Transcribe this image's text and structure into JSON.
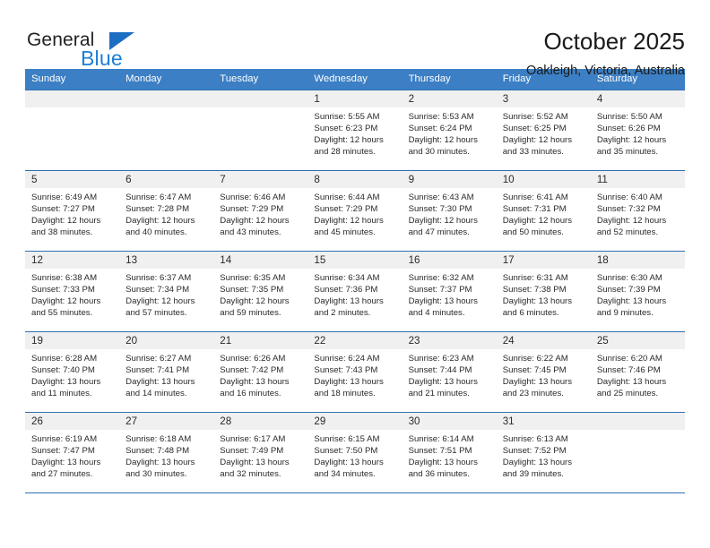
{
  "brand": {
    "name_top": "General",
    "name_bottom": "Blue",
    "triangle_color": "#1b6ec2",
    "blue_color": "#1b7fd4"
  },
  "header": {
    "title": "October 2025",
    "subtitle": "Oakleigh, Victoria, Australia"
  },
  "theme": {
    "header_row_bg": "#3c7fc4",
    "header_row_text": "#ffffff",
    "row_divider": "#2f6fae",
    "datenum_bg": "#f0f0f0",
    "text": "#2a2a2a"
  },
  "calendar": {
    "weekday_headers": [
      "Sunday",
      "Monday",
      "Tuesday",
      "Wednesday",
      "Thursday",
      "Friday",
      "Saturday"
    ],
    "labels": {
      "sunrise": "Sunrise:",
      "sunset": "Sunset:",
      "daylight": "Daylight:"
    },
    "weeks": [
      [
        {
          "day": "",
          "empty": true
        },
        {
          "day": "",
          "empty": true
        },
        {
          "day": "",
          "empty": true
        },
        {
          "day": "1",
          "sunrise": "Sunrise: 5:55 AM",
          "sunset": "Sunset: 6:23 PM",
          "daylight1": "Daylight: 12 hours",
          "daylight2": "and 28 minutes."
        },
        {
          "day": "2",
          "sunrise": "Sunrise: 5:53 AM",
          "sunset": "Sunset: 6:24 PM",
          "daylight1": "Daylight: 12 hours",
          "daylight2": "and 30 minutes."
        },
        {
          "day": "3",
          "sunrise": "Sunrise: 5:52 AM",
          "sunset": "Sunset: 6:25 PM",
          "daylight1": "Daylight: 12 hours",
          "daylight2": "and 33 minutes."
        },
        {
          "day": "4",
          "sunrise": "Sunrise: 5:50 AM",
          "sunset": "Sunset: 6:26 PM",
          "daylight1": "Daylight: 12 hours",
          "daylight2": "and 35 minutes."
        }
      ],
      [
        {
          "day": "5",
          "sunrise": "Sunrise: 6:49 AM",
          "sunset": "Sunset: 7:27 PM",
          "daylight1": "Daylight: 12 hours",
          "daylight2": "and 38 minutes."
        },
        {
          "day": "6",
          "sunrise": "Sunrise: 6:47 AM",
          "sunset": "Sunset: 7:28 PM",
          "daylight1": "Daylight: 12 hours",
          "daylight2": "and 40 minutes."
        },
        {
          "day": "7",
          "sunrise": "Sunrise: 6:46 AM",
          "sunset": "Sunset: 7:29 PM",
          "daylight1": "Daylight: 12 hours",
          "daylight2": "and 43 minutes."
        },
        {
          "day": "8",
          "sunrise": "Sunrise: 6:44 AM",
          "sunset": "Sunset: 7:29 PM",
          "daylight1": "Daylight: 12 hours",
          "daylight2": "and 45 minutes."
        },
        {
          "day": "9",
          "sunrise": "Sunrise: 6:43 AM",
          "sunset": "Sunset: 7:30 PM",
          "daylight1": "Daylight: 12 hours",
          "daylight2": "and 47 minutes."
        },
        {
          "day": "10",
          "sunrise": "Sunrise: 6:41 AM",
          "sunset": "Sunset: 7:31 PM",
          "daylight1": "Daylight: 12 hours",
          "daylight2": "and 50 minutes."
        },
        {
          "day": "11",
          "sunrise": "Sunrise: 6:40 AM",
          "sunset": "Sunset: 7:32 PM",
          "daylight1": "Daylight: 12 hours",
          "daylight2": "and 52 minutes."
        }
      ],
      [
        {
          "day": "12",
          "sunrise": "Sunrise: 6:38 AM",
          "sunset": "Sunset: 7:33 PM",
          "daylight1": "Daylight: 12 hours",
          "daylight2": "and 55 minutes."
        },
        {
          "day": "13",
          "sunrise": "Sunrise: 6:37 AM",
          "sunset": "Sunset: 7:34 PM",
          "daylight1": "Daylight: 12 hours",
          "daylight2": "and 57 minutes."
        },
        {
          "day": "14",
          "sunrise": "Sunrise: 6:35 AM",
          "sunset": "Sunset: 7:35 PM",
          "daylight1": "Daylight: 12 hours",
          "daylight2": "and 59 minutes."
        },
        {
          "day": "15",
          "sunrise": "Sunrise: 6:34 AM",
          "sunset": "Sunset: 7:36 PM",
          "daylight1": "Daylight: 13 hours",
          "daylight2": "and 2 minutes."
        },
        {
          "day": "16",
          "sunrise": "Sunrise: 6:32 AM",
          "sunset": "Sunset: 7:37 PM",
          "daylight1": "Daylight: 13 hours",
          "daylight2": "and 4 minutes."
        },
        {
          "day": "17",
          "sunrise": "Sunrise: 6:31 AM",
          "sunset": "Sunset: 7:38 PM",
          "daylight1": "Daylight: 13 hours",
          "daylight2": "and 6 minutes."
        },
        {
          "day": "18",
          "sunrise": "Sunrise: 6:30 AM",
          "sunset": "Sunset: 7:39 PM",
          "daylight1": "Daylight: 13 hours",
          "daylight2": "and 9 minutes."
        }
      ],
      [
        {
          "day": "19",
          "sunrise": "Sunrise: 6:28 AM",
          "sunset": "Sunset: 7:40 PM",
          "daylight1": "Daylight: 13 hours",
          "daylight2": "and 11 minutes."
        },
        {
          "day": "20",
          "sunrise": "Sunrise: 6:27 AM",
          "sunset": "Sunset: 7:41 PM",
          "daylight1": "Daylight: 13 hours",
          "daylight2": "and 14 minutes."
        },
        {
          "day": "21",
          "sunrise": "Sunrise: 6:26 AM",
          "sunset": "Sunset: 7:42 PM",
          "daylight1": "Daylight: 13 hours",
          "daylight2": "and 16 minutes."
        },
        {
          "day": "22",
          "sunrise": "Sunrise: 6:24 AM",
          "sunset": "Sunset: 7:43 PM",
          "daylight1": "Daylight: 13 hours",
          "daylight2": "and 18 minutes."
        },
        {
          "day": "23",
          "sunrise": "Sunrise: 6:23 AM",
          "sunset": "Sunset: 7:44 PM",
          "daylight1": "Daylight: 13 hours",
          "daylight2": "and 21 minutes."
        },
        {
          "day": "24",
          "sunrise": "Sunrise: 6:22 AM",
          "sunset": "Sunset: 7:45 PM",
          "daylight1": "Daylight: 13 hours",
          "daylight2": "and 23 minutes."
        },
        {
          "day": "25",
          "sunrise": "Sunrise: 6:20 AM",
          "sunset": "Sunset: 7:46 PM",
          "daylight1": "Daylight: 13 hours",
          "daylight2": "and 25 minutes."
        }
      ],
      [
        {
          "day": "26",
          "sunrise": "Sunrise: 6:19 AM",
          "sunset": "Sunset: 7:47 PM",
          "daylight1": "Daylight: 13 hours",
          "daylight2": "and 27 minutes."
        },
        {
          "day": "27",
          "sunrise": "Sunrise: 6:18 AM",
          "sunset": "Sunset: 7:48 PM",
          "daylight1": "Daylight: 13 hours",
          "daylight2": "and 30 minutes."
        },
        {
          "day": "28",
          "sunrise": "Sunrise: 6:17 AM",
          "sunset": "Sunset: 7:49 PM",
          "daylight1": "Daylight: 13 hours",
          "daylight2": "and 32 minutes."
        },
        {
          "day": "29",
          "sunrise": "Sunrise: 6:15 AM",
          "sunset": "Sunset: 7:50 PM",
          "daylight1": "Daylight: 13 hours",
          "daylight2": "and 34 minutes."
        },
        {
          "day": "30",
          "sunrise": "Sunrise: 6:14 AM",
          "sunset": "Sunset: 7:51 PM",
          "daylight1": "Daylight: 13 hours",
          "daylight2": "and 36 minutes."
        },
        {
          "day": "31",
          "sunrise": "Sunrise: 6:13 AM",
          "sunset": "Sunset: 7:52 PM",
          "daylight1": "Daylight: 13 hours",
          "daylight2": "and 39 minutes."
        },
        {
          "day": "",
          "empty": true
        }
      ]
    ]
  }
}
